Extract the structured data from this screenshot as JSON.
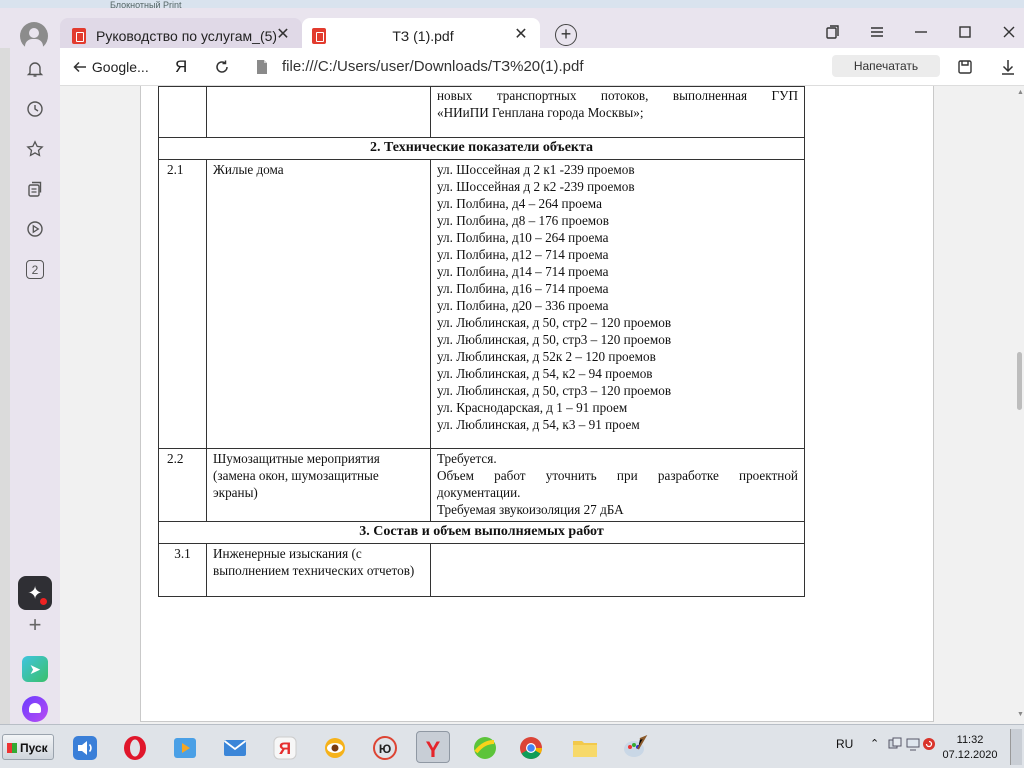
{
  "underlay": {
    "text": "Блокнотный  Print"
  },
  "browser": {
    "tabs": [
      {
        "title": "Руководство по услугам_(5)",
        "active": false
      },
      {
        "title": "ТЗ (1).pdf",
        "active": true
      }
    ],
    "close_glyph": "✕",
    "new_tab_glyph": "+",
    "back_label": "Google...",
    "yandex_glyph": "Я",
    "url": "file:///C:/Users/user/Downloads/ТЗ%20(1).pdf",
    "print_label": "Напечатать",
    "sidebar_badge": "2",
    "accent_color": "#e9e4ee"
  },
  "document": {
    "rows": [
      {
        "type": "cont",
        "lines": [
          "новых   транспортных   потоков,   выполненная   ГУП",
          "«НИиПИ Генплана города Москвы»;"
        ]
      },
      {
        "type": "section",
        "title": "2.   Технические показатели объекта"
      },
      {
        "type": "row",
        "num": "2.1",
        "name": "Жилые дома",
        "items": [
          "ул. Шоссейная д 2 к1 -239 проемов",
          "ул. Шоссейная д 2 к2 -239 проемов",
          "ул. Полбина, д4 – 264 проема",
          "ул. Полбина, д8 – 176 проемов",
          "ул. Полбина, д10 – 264 проема",
          "ул. Полбина, д12 – 714 проема",
          "ул. Полбина, д14 – 714 проема",
          "ул. Полбина, д16 – 714 проема",
          "ул. Полбина, д20 – 336 проема",
          "ул. Люблинская, д 50, стр2 – 120 проемов",
          "ул. Люблинская, д 50, стр3 – 120 проемов",
          "ул. Люблинская, д 52к 2 – 120 проемов",
          "ул. Люблинская, д 54, к2 – 94 проемов",
          "ул. Люблинская, д 50, стр3 – 120 проемов",
          "ул. Краснодарская, д 1 – 91 проем",
          "ул. Люблинская, д 54, к3 – 91 проем"
        ]
      },
      {
        "type": "row",
        "num": "2.2",
        "name": "Шумозащитные мероприятия (замена окон, шумозащитные экраны)",
        "value_lines": [
          "Требуется.",
          "Объем   работ   уточнить   при   разработке   проектной",
          "документации.",
          "Требуемая звукоизоляция 27 дБА"
        ]
      },
      {
        "type": "section",
        "title": "3.   Состав и объем выполняемых работ"
      },
      {
        "type": "row",
        "num": "3.1",
        "name": "Инженерные изыскания (с выполнением технических отчетов)",
        "value_lines": []
      }
    ]
  },
  "taskbar": {
    "start_label": "Пуск",
    "apps": [
      "sound",
      "opera",
      "media",
      "mail",
      "yandex-browser",
      "eye",
      "yu",
      "yandex",
      "green-app",
      "chrome",
      "folder",
      "paint"
    ],
    "lang": "RU",
    "time": "11:32",
    "date": "07.12.2020"
  }
}
